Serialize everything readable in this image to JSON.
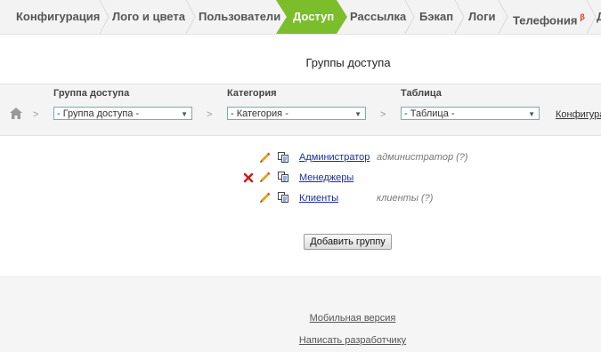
{
  "tabs": [
    {
      "label": "Конфигурация",
      "active": false
    },
    {
      "label": "Лого и цвета",
      "active": false
    },
    {
      "label": "Пользователи",
      "active": false
    },
    {
      "label": "Доступ",
      "active": true
    },
    {
      "label": "Рассылка",
      "active": false
    },
    {
      "label": "Бэкап",
      "active": false
    },
    {
      "label": "Логи",
      "active": false
    },
    {
      "label": "Телефония",
      "active": false,
      "badge": "β"
    },
    {
      "label": "Д",
      "active": false
    }
  ],
  "page_title": "Группы доступа",
  "filter": {
    "separator": ">",
    "group_label": "Группа доступа",
    "group_value": "- Группа доступа -",
    "category_label": "Категория",
    "category_value": "- Категория -",
    "table_label": "Таблица",
    "table_value": "- Таблица -",
    "config_link": "Конфигура"
  },
  "groups": [
    {
      "name": "Администратор",
      "role": "администратор (?)",
      "deletable": false
    },
    {
      "name": "Менеджеры",
      "role": "",
      "deletable": true
    },
    {
      "name": "Клиенты",
      "role": "клиенты (?)",
      "deletable": false
    }
  ],
  "add_group_button": "Добавить группу",
  "footer": {
    "mobile_link": "Мобильная версия",
    "contact_link": "Написать разработчику"
  },
  "colors": {
    "active_tab": "#7bbd2b",
    "link": "#1a2ea8",
    "delete_icon": "#cc1f1f",
    "edit_icon": "#e9a21a"
  },
  "icons": [
    "home-icon",
    "pencil-icon",
    "copy-icon",
    "delete-icon",
    "chevron-right-icon",
    "dropdown-arrow-icon"
  ]
}
